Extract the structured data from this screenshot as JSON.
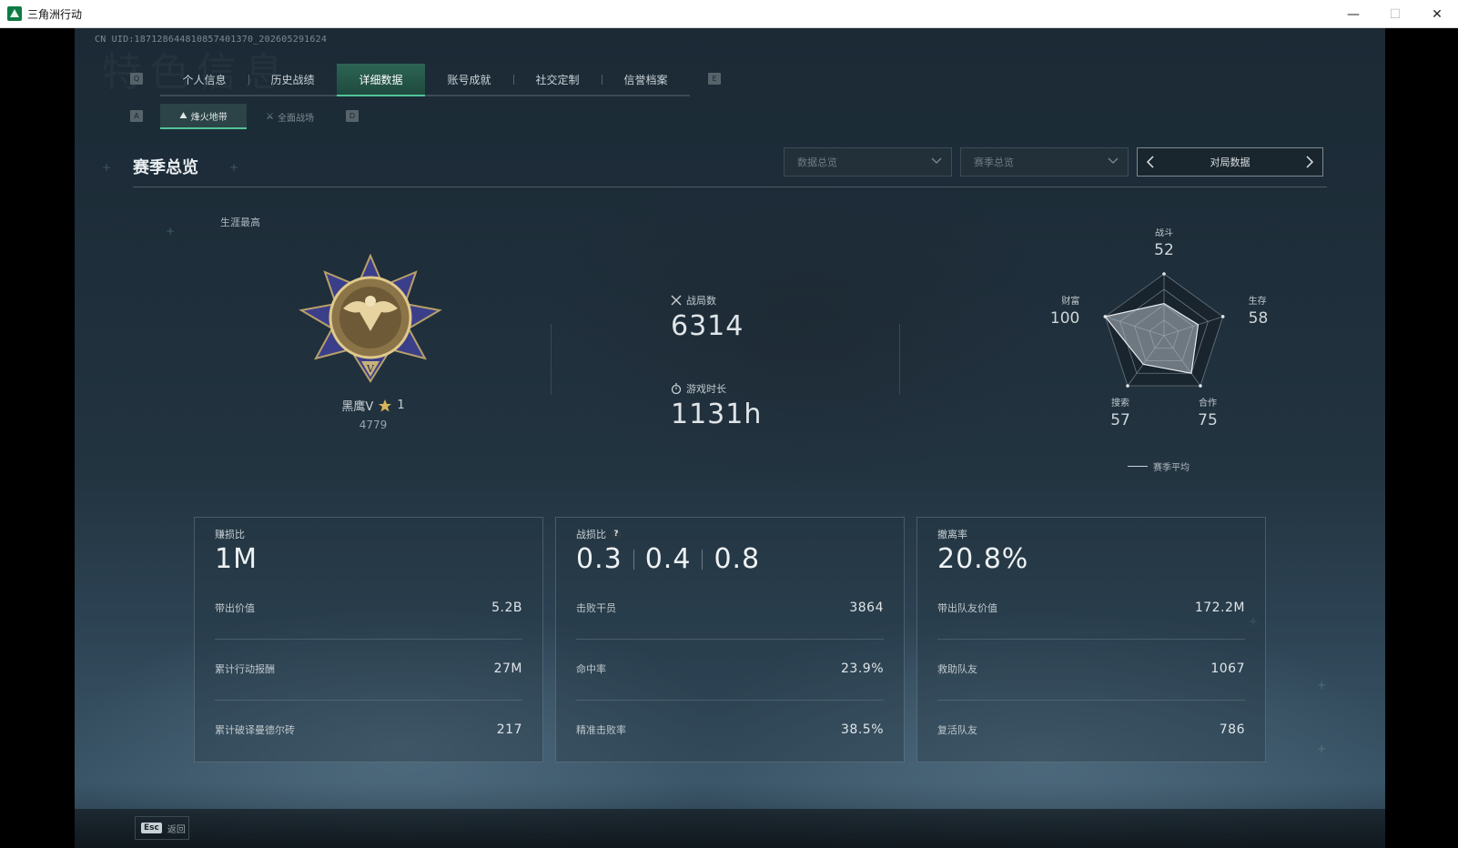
{
  "window": {
    "title": "三角洲行动",
    "minimize": "—",
    "maximize": "☐",
    "close": "✕"
  },
  "header": {
    "uid": "CN UID:1871286448108574013​70_2026052​91624",
    "watermark": "特色信息"
  },
  "main_tabs": {
    "key_left": "Q",
    "key_right": "E",
    "items": [
      {
        "label": "个人信息"
      },
      {
        "label": "历史战绩"
      },
      {
        "label": "详细数据"
      },
      {
        "label": "账号成就"
      },
      {
        "label": "社交定制"
      },
      {
        "label": "信誉档案"
      }
    ]
  },
  "sub_tabs": {
    "key_left": "A",
    "key_right": "D",
    "items": [
      {
        "label": "烽火地带",
        "icon": "⛰"
      },
      {
        "label": "全面战场",
        "icon": "⚔"
      }
    ]
  },
  "section": {
    "title": "赛季总览",
    "dropdown1": "数据总览",
    "dropdown2": "赛季总览",
    "pager_label": "对局数据"
  },
  "overview": {
    "career_label": "生涯最高",
    "rank_name": "黑鹰V",
    "rank_stars": "1",
    "rank_score": "4779",
    "matches_label": "战局数",
    "matches_value": "6314",
    "playtime_label": "游戏时长",
    "playtime_value": "1131h"
  },
  "radar": {
    "axes": [
      {
        "label": "战斗",
        "value": "52",
        "score": 52
      },
      {
        "label": "生存",
        "value": "58",
        "score": 58
      },
      {
        "label": "合作",
        "value": "75",
        "score": 75
      },
      {
        "label": "搜索",
        "value": "57",
        "score": 57
      },
      {
        "label": "财富",
        "value": "100",
        "score": 100
      }
    ],
    "legend": "赛季平均"
  },
  "cards": {
    "profit": {
      "label": "赚损比",
      "hero": "1M",
      "rows": [
        {
          "label": "带出价值",
          "value": "5.2B"
        },
        {
          "label": "累计行动报酬",
          "value": "27M"
        },
        {
          "label": "累计破译曼德尔砖",
          "value": "217"
        }
      ]
    },
    "combat": {
      "label": "战损比",
      "help": "?",
      "hero1": "0.3",
      "hero2": "0.4",
      "hero3": "0.8",
      "rows": [
        {
          "label": "击败干员",
          "value": "3864"
        },
        {
          "label": "命中率",
          "value": "23.9%"
        },
        {
          "label": "精准击败率",
          "value": "38.5%"
        }
      ]
    },
    "extract": {
      "label": "撤离率",
      "hero": "20.8%",
      "rows": [
        {
          "label": "带出队友价值",
          "value": "172.2M"
        },
        {
          "label": "救助队友",
          "value": "1067"
        },
        {
          "label": "复活队友",
          "value": "786"
        }
      ]
    }
  },
  "footer": {
    "esc_key": "Esc",
    "esc_label": "返回"
  },
  "colors": {
    "accent": "#52c39a",
    "active_tab_bg": "#2d6453",
    "background": "#1e2e3a"
  }
}
